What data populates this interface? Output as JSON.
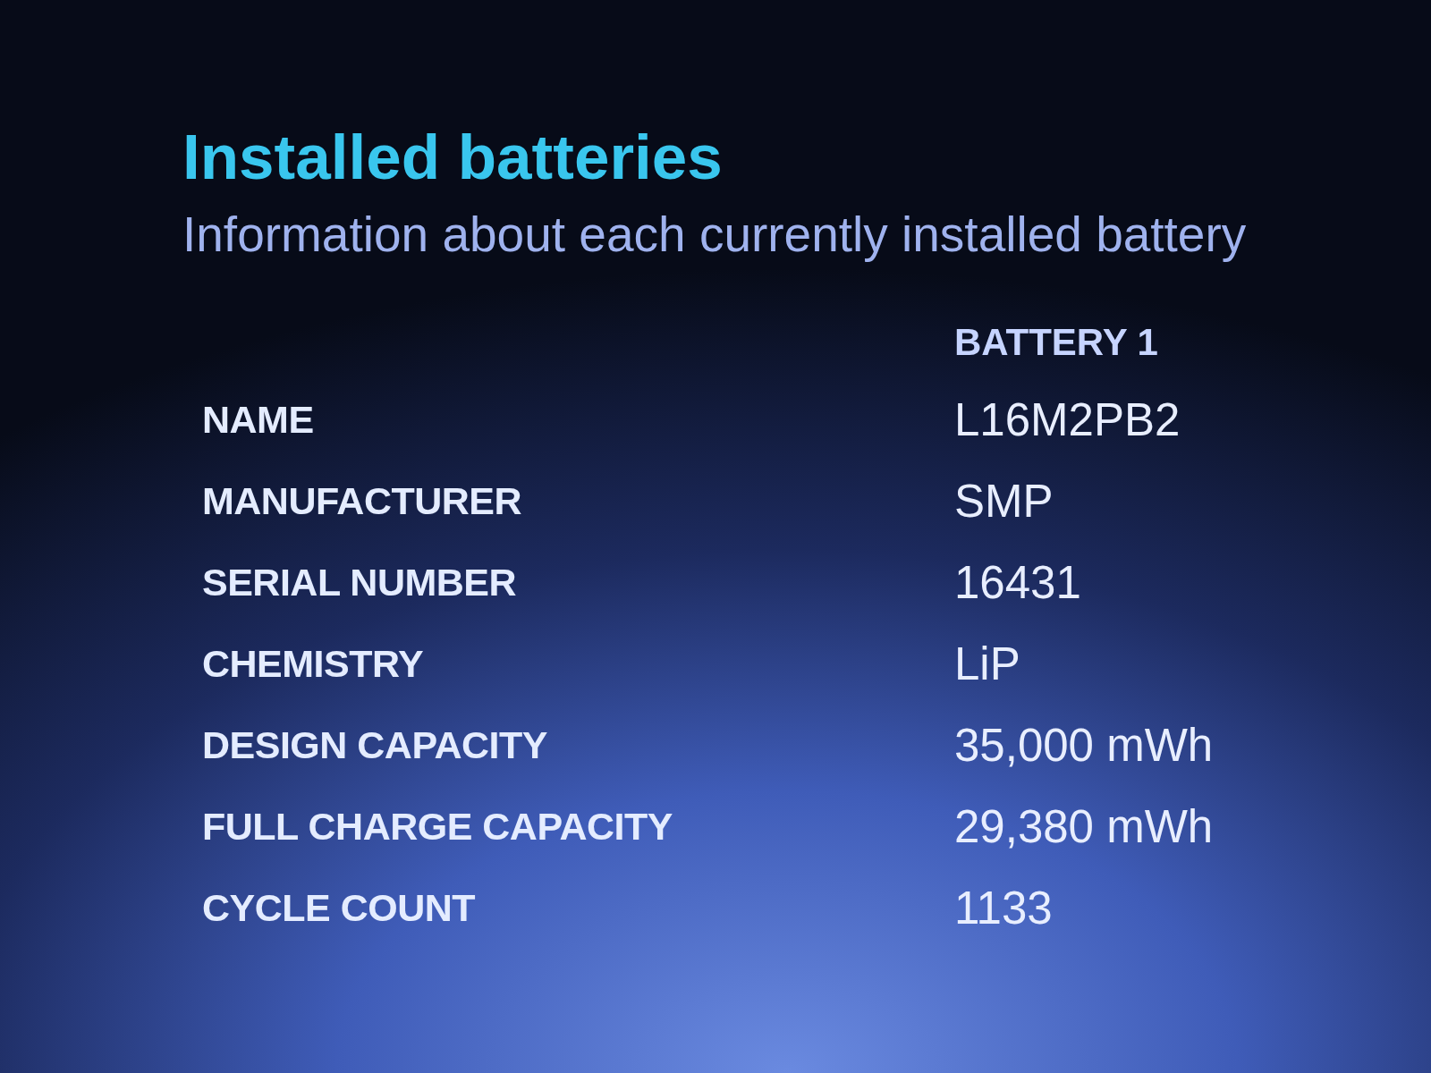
{
  "title": "Installed batteries",
  "subtitle": "Information about each currently installed battery",
  "table": {
    "columns": [
      "BATTERY 1"
    ],
    "rows": [
      {
        "label": "NAME",
        "value": "L16M2PB2"
      },
      {
        "label": "MANUFACTURER",
        "value": "SMP"
      },
      {
        "label": "SERIAL NUMBER",
        "value": "16431"
      },
      {
        "label": "CHEMISTRY",
        "value": "LiP"
      },
      {
        "label": "DESIGN CAPACITY",
        "value": "35,000 mWh"
      },
      {
        "label": "FULL CHARGE CAPACITY",
        "value": "29,380 mWh"
      },
      {
        "label": "CYCLE COUNT",
        "value": "1133"
      }
    ]
  }
}
